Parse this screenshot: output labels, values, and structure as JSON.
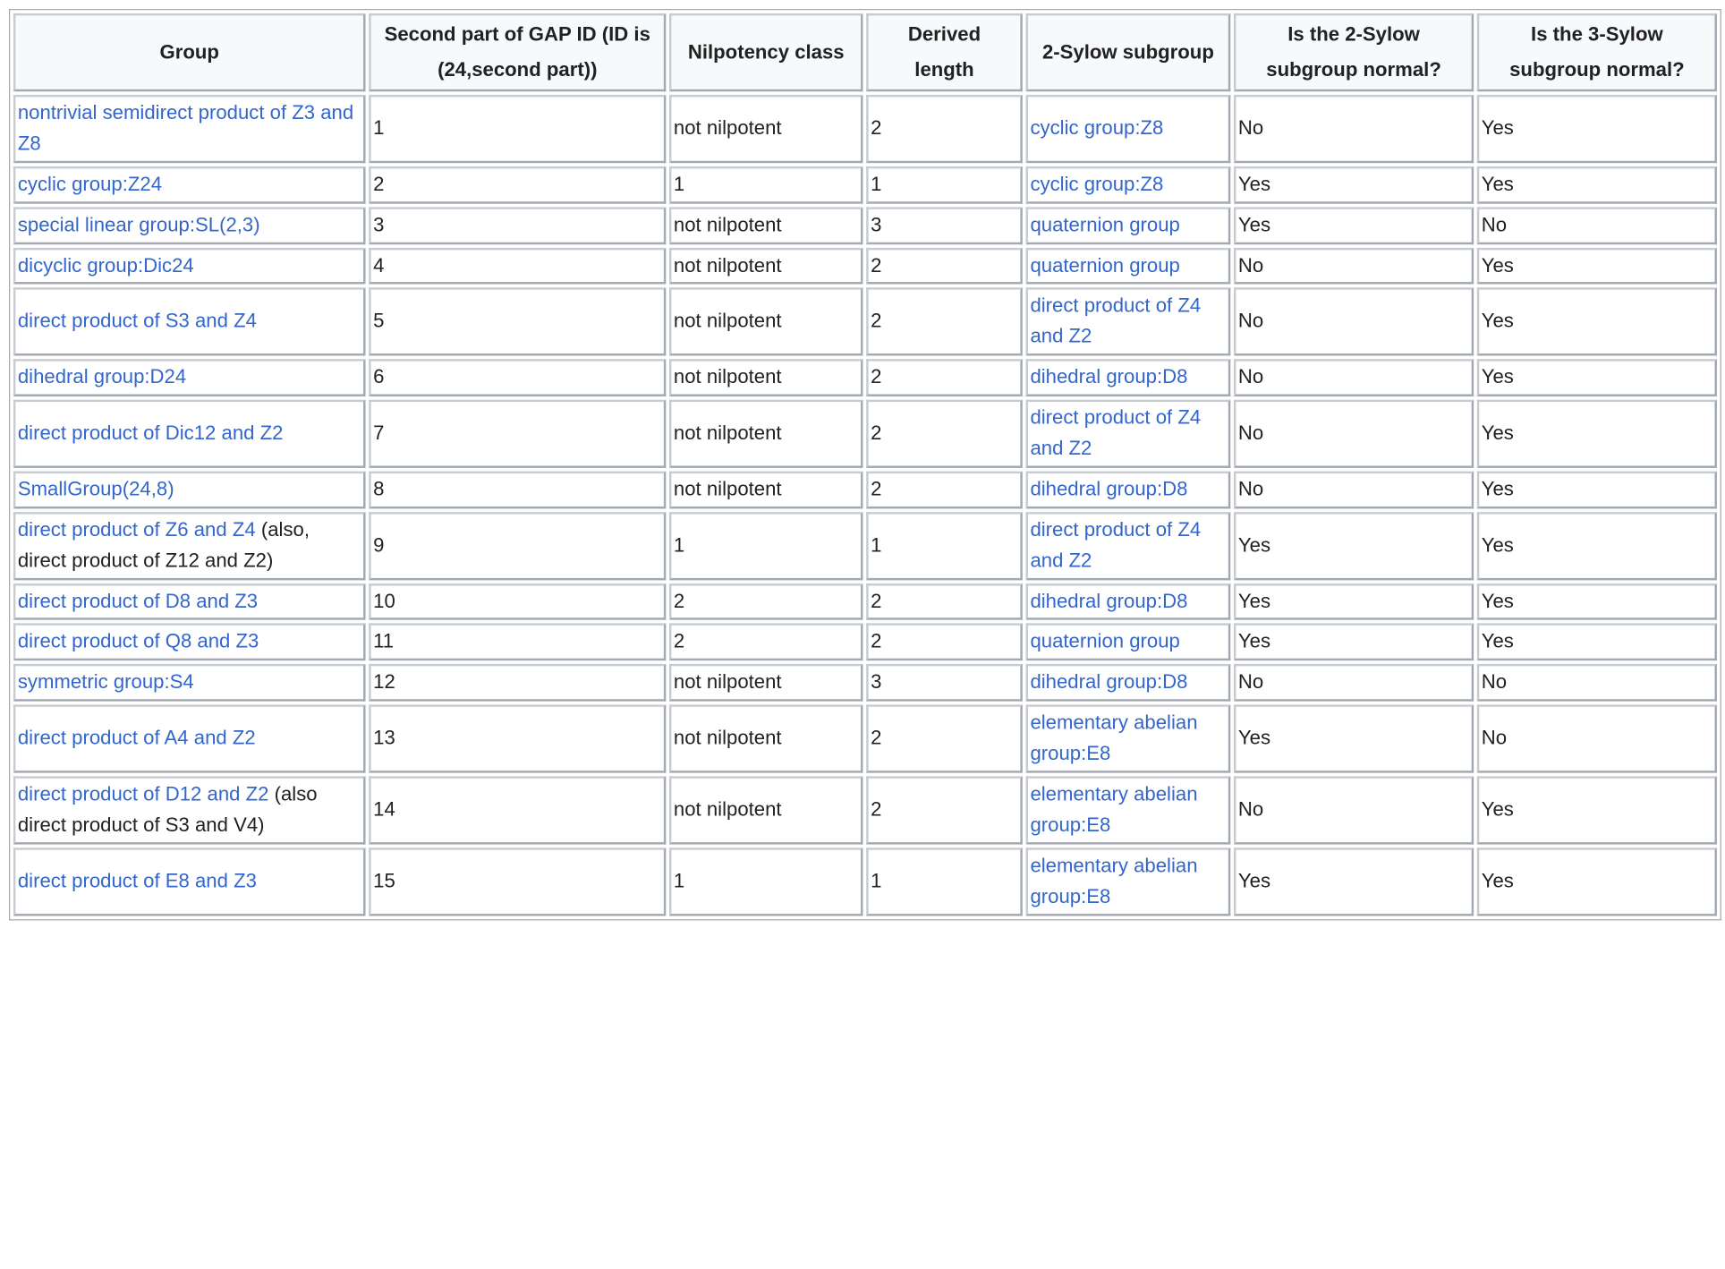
{
  "headers": {
    "group": "Group",
    "gap_id": "Second part of GAP ID (ID is (24,second part))",
    "nilpotency_class": "Nilpotency class",
    "derived_length": "Derived length",
    "sylow2": "2-Sylow subgroup",
    "sylow2_normal": "Is the 2-Sylow subgroup normal?",
    "sylow3_normal": "Is the 3-Sylow subgroup normal?"
  },
  "rows": [
    {
      "group": "nontrivial semidirect product of Z3 and Z8",
      "group_note": "",
      "gap_id": "1",
      "nilpotency_class": "not nilpotent",
      "derived_length": "2",
      "sylow2": "cyclic group:Z8",
      "sylow2_normal": "No",
      "sylow3_normal": "Yes"
    },
    {
      "group": "cyclic group:Z24",
      "group_note": "",
      "gap_id": "2",
      "nilpotency_class": "1",
      "derived_length": "1",
      "sylow2": "cyclic group:Z8",
      "sylow2_normal": "Yes",
      "sylow3_normal": "Yes"
    },
    {
      "group": "special linear group:SL(2,3)",
      "group_note": "",
      "gap_id": "3",
      "nilpotency_class": "not nilpotent",
      "derived_length": "3",
      "sylow2": "quaternion group",
      "sylow2_normal": "Yes",
      "sylow3_normal": "No"
    },
    {
      "group": "dicyclic group:Dic24",
      "group_note": "",
      "gap_id": "4",
      "nilpotency_class": "not nilpotent",
      "derived_length": "2",
      "sylow2": "quaternion group",
      "sylow2_normal": "No",
      "sylow3_normal": "Yes"
    },
    {
      "group": "direct product of S3 and Z4",
      "group_note": "",
      "gap_id": "5",
      "nilpotency_class": "not nilpotent",
      "derived_length": "2",
      "sylow2": "direct product of Z4 and Z2",
      "sylow2_normal": "No",
      "sylow3_normal": "Yes"
    },
    {
      "group": "dihedral group:D24",
      "group_note": "",
      "gap_id": "6",
      "nilpotency_class": "not nilpotent",
      "derived_length": "2",
      "sylow2": "dihedral group:D8",
      "sylow2_normal": "No",
      "sylow3_normal": "Yes"
    },
    {
      "group": "direct product of Dic12 and Z2",
      "group_note": "",
      "gap_id": "7",
      "nilpotency_class": "not nilpotent",
      "derived_length": "2",
      "sylow2": "direct product of Z4 and Z2",
      "sylow2_normal": "No",
      "sylow3_normal": "Yes"
    },
    {
      "group": "SmallGroup(24,8)",
      "group_note": "",
      "gap_id": "8",
      "nilpotency_class": "not nilpotent",
      "derived_length": "2",
      "sylow2": "dihedral group:D8",
      "sylow2_normal": "No",
      "sylow3_normal": "Yes"
    },
    {
      "group": "direct product of Z6 and Z4",
      "group_note": "(also, direct product of Z12 and Z2)",
      "gap_id": "9",
      "nilpotency_class": "1",
      "derived_length": "1",
      "sylow2": "direct product of Z4 and Z2",
      "sylow2_normal": "Yes",
      "sylow3_normal": "Yes"
    },
    {
      "group": "direct product of D8 and Z3",
      "group_note": "",
      "gap_id": "10",
      "nilpotency_class": "2",
      "derived_length": "2",
      "sylow2": "dihedral group:D8",
      "sylow2_normal": "Yes",
      "sylow3_normal": "Yes"
    },
    {
      "group": "direct product of Q8 and Z3",
      "group_note": "",
      "gap_id": "11",
      "nilpotency_class": "2",
      "derived_length": "2",
      "sylow2": "quaternion group",
      "sylow2_normal": "Yes",
      "sylow3_normal": "Yes"
    },
    {
      "group": "symmetric group:S4",
      "group_note": "",
      "gap_id": "12",
      "nilpotency_class": "not nilpotent",
      "derived_length": "3",
      "sylow2": "dihedral group:D8",
      "sylow2_normal": "No",
      "sylow3_normal": "No"
    },
    {
      "group": "direct product of A4 and Z2",
      "group_note": "",
      "gap_id": "13",
      "nilpotency_class": "not nilpotent",
      "derived_length": "2",
      "sylow2": "elementary abelian group:E8",
      "sylow2_normal": "Yes",
      "sylow3_normal": "No"
    },
    {
      "group": "direct product of D12 and Z2",
      "group_note": "(also direct product of S3 and V4)",
      "gap_id": "14",
      "nilpotency_class": "not nilpotent",
      "derived_length": "2",
      "sylow2": "elementary abelian group:E8",
      "sylow2_normal": "No",
      "sylow3_normal": "Yes"
    },
    {
      "group": "direct product of E8 and Z3",
      "group_note": "",
      "gap_id": "15",
      "nilpotency_class": "1",
      "derived_length": "1",
      "sylow2": "elementary abelian group:E8",
      "sylow2_normal": "Yes",
      "sylow3_normal": "Yes"
    }
  ]
}
